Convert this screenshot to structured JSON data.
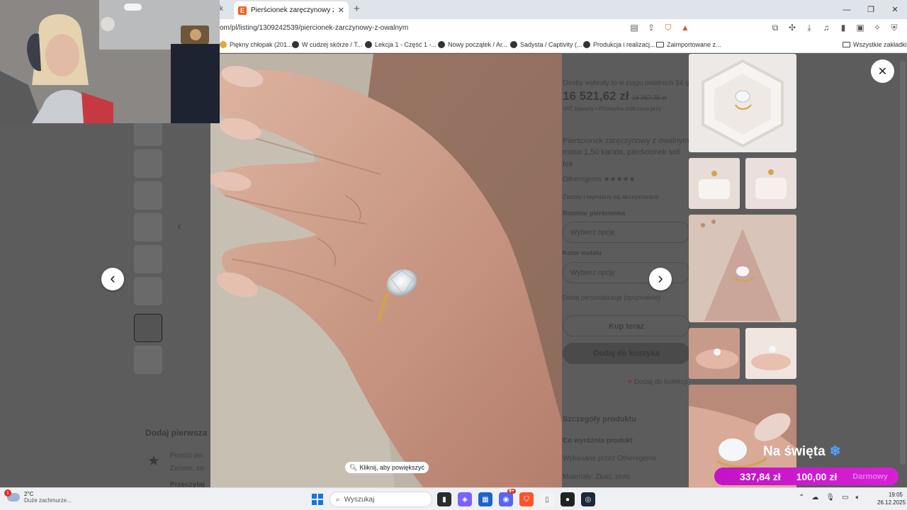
{
  "browser": {
    "tabs": [
      {
        "title": "Pierścionek zaręczynowy z owaln",
        "active": true
      }
    ],
    "prev_tab_fragment": "k",
    "url": "om/pl/listing/1309242539/piercionek-zarczynowy-z-owalnym",
    "bookmarks": [
      "Piękny chłopak (201...",
      "W cudzej skórze / T...",
      "Lekcja 1 - Część 1 -...",
      "Nowy początek / Ar...",
      "Sadysta / Captivity (...",
      "Produkcja i realizacj...",
      "Zaimportowane z...",
      "Wszystkie zakładki"
    ],
    "shield_badge": "6",
    "alert_badge": "1"
  },
  "listing_behind": {
    "notice": "Osoby wybrały to w ciągu ostatnich 24 g",
    "price": "16 521,62 zł",
    "old_price": "18 357,35 zł",
    "vat_line": "VAT zawarty • Przesyłka obliczona przy",
    "description": "Pierścionek zaręczynowy z owalnym",
    "description2": "masa 1,50 karata, pierścionek soli",
    "description3": "fek",
    "seller": "Otheregems ★★★★★",
    "returns": "Zwroty i wymiany są akceptowane",
    "size_label": "Rozmiar pierścionka",
    "size_placeholder": "Wybierz opcję",
    "metal_label": "Kolor metalu",
    "metal_placeholder": "Wybierz opcję",
    "personalize": "Dodaj personalizację (opcjonalnie)",
    "buy_now": "Kup teraz",
    "add_to_cart": "Dodaj do koszyka",
    "add_to_collection": "Dodaj do kolekcji",
    "details_heading": "Szczegóły produktu",
    "production_heading": "Co wyróżnia produkt",
    "made_by": "Wykonane przez Otheregems",
    "material": "Materiały: Złoto, złoto",
    "reviews_heading": "Dodaj pierwsza",
    "review_line1": "Pomóż inn",
    "review_line2": "Zaświe, co",
    "review_line3": "Przeczytaj"
  },
  "lightbox": {
    "zoom_hint": "Kliknij, aby powiększyć",
    "prev_label": "‹",
    "next_label": "›",
    "close_label": "✕"
  },
  "promo": {
    "title": "Na święta",
    "value_main": "337,84 zł",
    "value_second": "100,00 zł",
    "value_faded": "Darmowy"
  },
  "taskbar": {
    "weather_temp": "2°C",
    "weather_desc": "Duże zachmurze...",
    "weather_badge": "1",
    "search_placeholder": "Wyszukaj",
    "discord_badge": "9+",
    "time": "19:05",
    "date": "26.12.2025"
  },
  "colors": {
    "accent_etsy": "#f1641e",
    "promo_magenta": "#d81fd6",
    "overlay": "#5c5c5c"
  }
}
